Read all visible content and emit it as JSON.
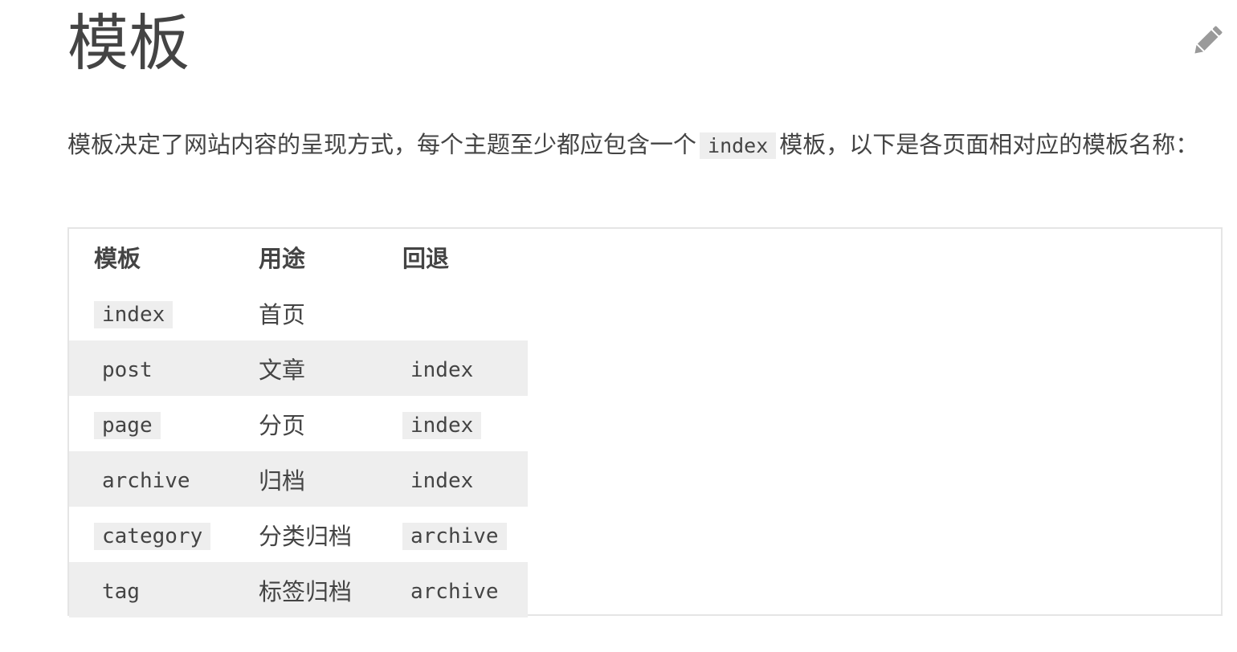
{
  "page": {
    "title": "模板",
    "edit_icon": "pencil-icon"
  },
  "intro": {
    "before": "模板决定了网站内容的呈现方式，每个主题至少都应包含一个",
    "code": "index",
    "after": "模板，以下是各页面相对应的模板名称："
  },
  "table": {
    "headers": [
      "模板",
      "用途",
      "回退"
    ],
    "rows": [
      {
        "template": "index",
        "usage": "首页",
        "fallback": ""
      },
      {
        "template": "post",
        "usage": "文章",
        "fallback": "index"
      },
      {
        "template": "page",
        "usage": "分页",
        "fallback": "index"
      },
      {
        "template": "archive",
        "usage": "归档",
        "fallback": "index"
      },
      {
        "template": "category",
        "usage": "分类归档",
        "fallback": "archive"
      },
      {
        "template": "tag",
        "usage": "标签归档",
        "fallback": "archive"
      }
    ]
  }
}
